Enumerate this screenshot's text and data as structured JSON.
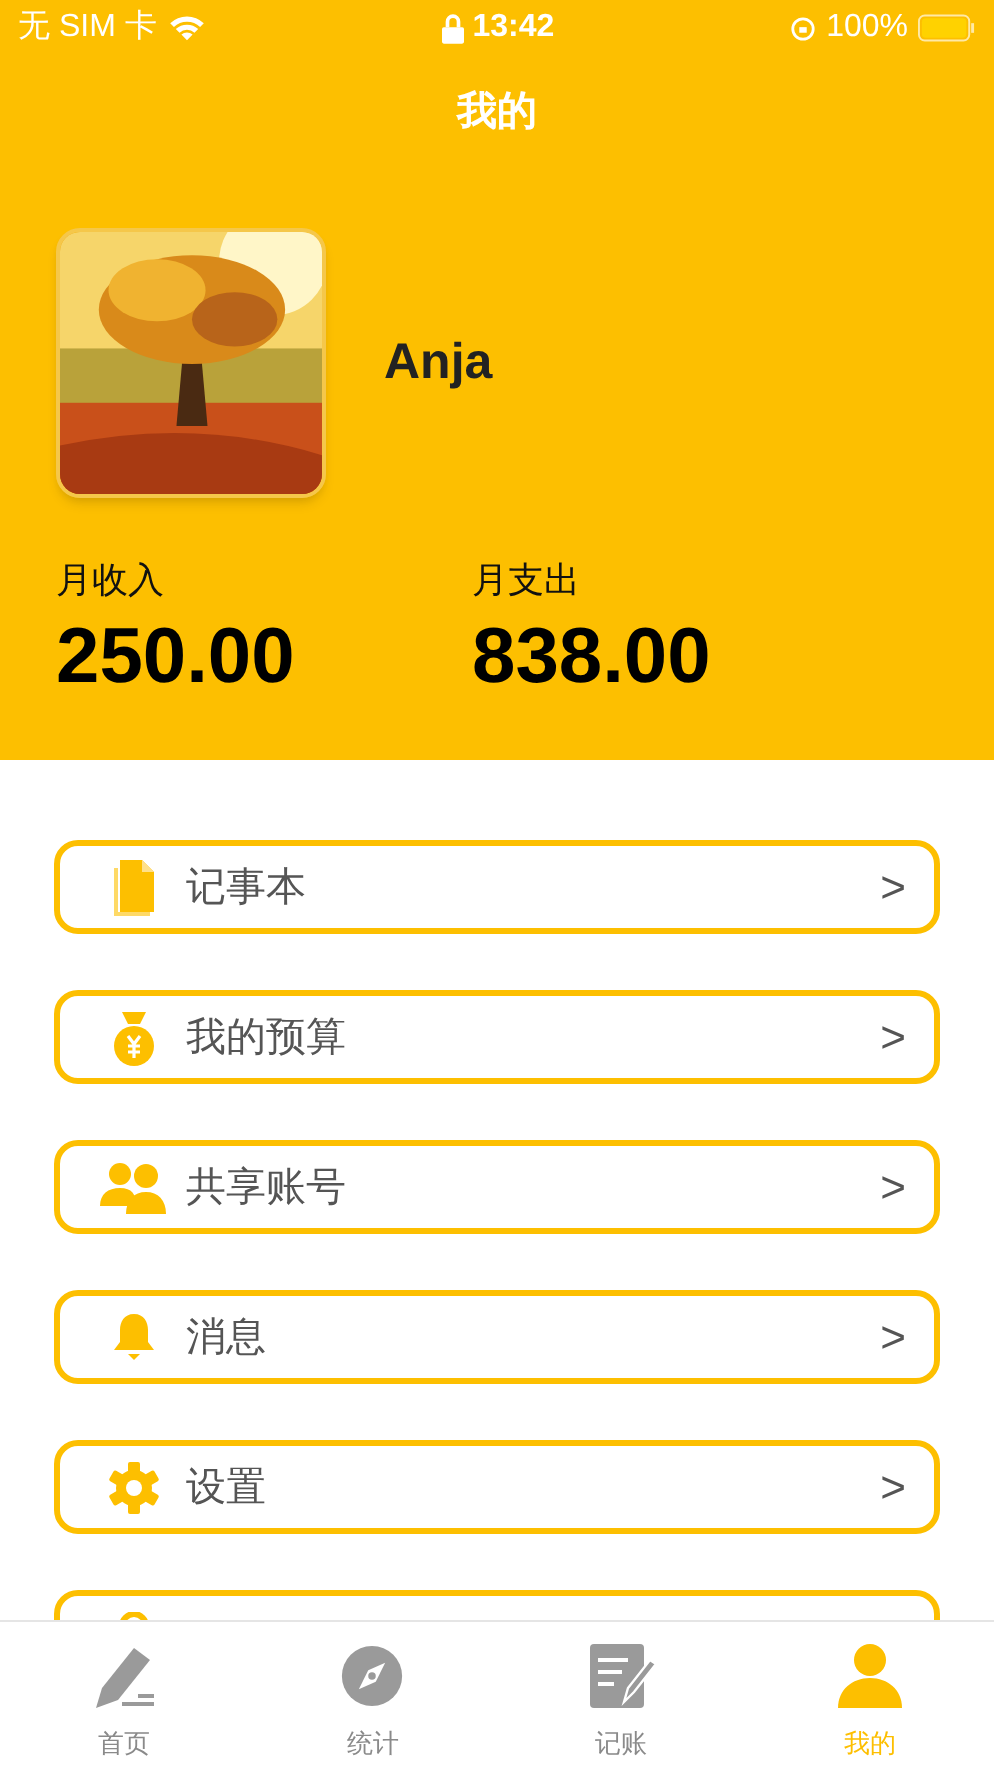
{
  "status_bar": {
    "carrier": "无 SIM 卡",
    "time": "13:42",
    "battery": "100%"
  },
  "title": "我的",
  "profile": {
    "name": "Anja"
  },
  "stats": [
    {
      "label": "月收入",
      "value": "250.00"
    },
    {
      "label": "月支出",
      "value": "838.00"
    }
  ],
  "menu": [
    {
      "kind": "link",
      "label": "记事本",
      "arrow": ">"
    },
    {
      "kind": "link",
      "label": "我的预算",
      "arrow": ">"
    },
    {
      "kind": "link",
      "label": "共享账号",
      "arrow": ">"
    },
    {
      "kind": "link",
      "label": "消息",
      "arrow": ">"
    },
    {
      "kind": "link",
      "label": "设置",
      "arrow": ">"
    },
    {
      "kind": "link"
    }
  ],
  "tabs": [
    {
      "label": "首页",
      "selected": false
    },
    {
      "label": "统计",
      "selected": false
    },
    {
      "label": "记账",
      "selected": false
    },
    {
      "label": "我的",
      "selected": true
    }
  ]
}
